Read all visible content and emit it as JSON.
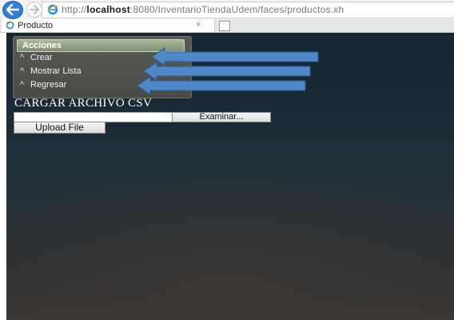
{
  "browser": {
    "url_prefix": "http://",
    "url_host": "localhost",
    "url_rest": ":8080/InventarioTiendaUdem/faces/productos.xh",
    "tab_title": "Producto",
    "tab_close": "×"
  },
  "menu": {
    "header": "Acciones",
    "items": [
      {
        "caret": "^",
        "label": "Crear"
      },
      {
        "caret": "^",
        "label": "Mostrar Lista"
      },
      {
        "caret": "^",
        "label": "Regresar"
      }
    ]
  },
  "upload": {
    "title": "CARGAR ARCHIVO CSV",
    "browse_label": "Examinar...",
    "upload_label": "Upload File"
  },
  "colors": {
    "arrow": "#4f88c8",
    "header_bg": "#8fa184",
    "back_button": "#2f7fd6"
  },
  "icons": [
    "back-arrow-icon",
    "forward-arrow-icon",
    "ie-icon",
    "tab-favicon-icon",
    "close-tab-icon",
    "new-tab-icon",
    "annotation-arrow-icon"
  ]
}
